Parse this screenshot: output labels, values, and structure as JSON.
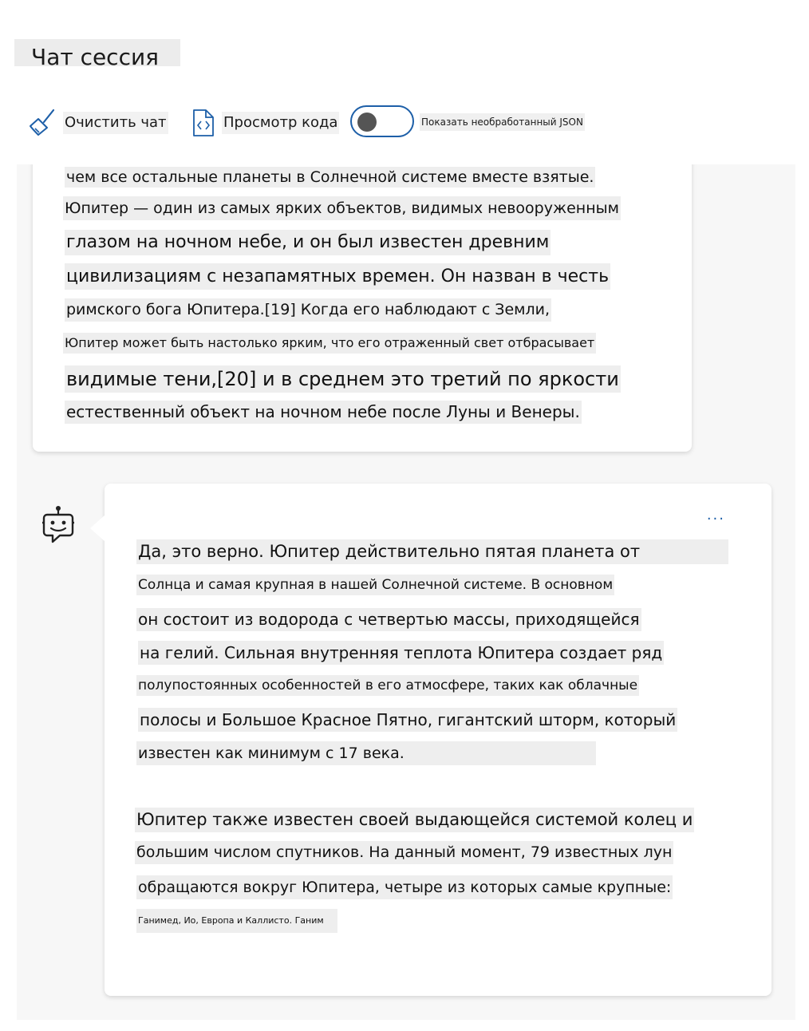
{
  "header": {
    "title": "Чат сессия"
  },
  "toolbar": {
    "clear_label": "Очистить чат",
    "code_label": "Просмотр кода",
    "json_toggle_label": "Показать необработанный JSON",
    "json_toggle_on": false
  },
  "messages": {
    "previous": {
      "lines": [
        "чем все остальные планеты в Солнечной системе вместе взятые.",
        "Юпитер — один из самых ярких объектов, видимых невооруженным",
        "глазом на ночном небе, и он был известен древним",
        "цивилизациям с незапамятных времен. Он назван в честь",
        "римского бога Юпитера.[19] Когда его наблюдают с Земли,",
        "Юпитер может быть настолько ярким, что его отраженный свет отбрасывает",
        "видимые тени,[20] и в среднем это третий по яркости",
        "естественный объект на ночном небе после Луны и Венеры."
      ]
    },
    "bot": {
      "more_label": "...",
      "paragraph1": [
        "Да, это верно. Юпитер действительно пятая планета от",
        "Солнца и самая крупная в нашей Солнечной системе. В основном",
        "он состоит из водорода с четвертью массы, приходящейся",
        "на гелий. Сильная внутренняя теплота Юпитера создает ряд",
        "полупостоянных особенностей в его атмосфере, таких как облачные",
        "полосы и Большое Красное Пятно, гигантский шторм, который",
        "известен как минимум с 17 века."
      ],
      "paragraph2": [
        "Юпитер также известен своей выдающейся системой колец и",
        "большим числом спутников. На данный момент, 79 известных лун",
        "обращаются вокруг Юпитера, четыре из которых самые крупные:",
        "Ганимед, Ио, Европа и Каллисто. Ганим"
      ]
    }
  }
}
